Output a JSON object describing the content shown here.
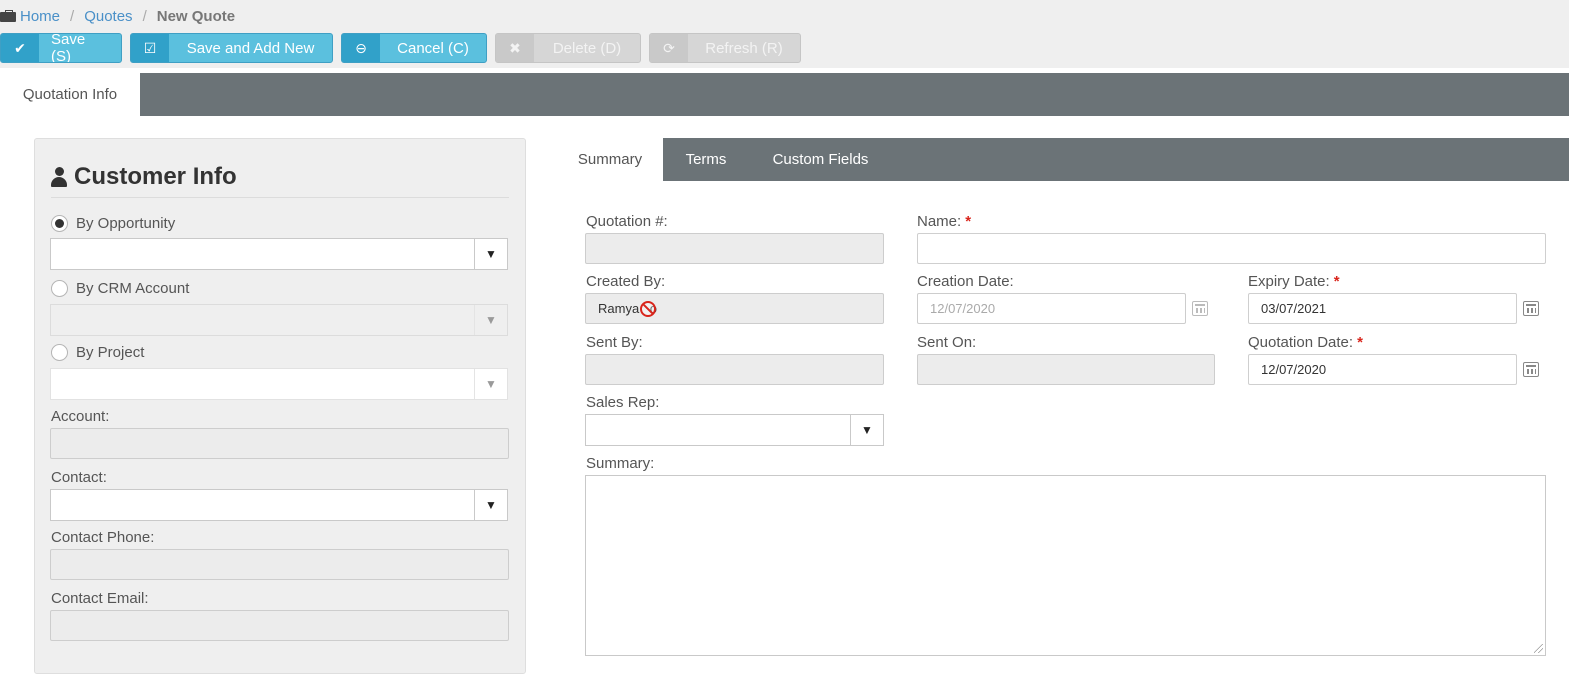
{
  "breadcrumb": {
    "home": "Home",
    "sep1": "/",
    "quotes": "Quotes",
    "sep2": "/",
    "current": "New Quote"
  },
  "toolbar": {
    "save": "Save (S)",
    "save_add": "Save and Add New",
    "cancel": "Cancel (C)",
    "delete": "Delete (D)",
    "refresh": "Refresh (R)"
  },
  "icons": {
    "save": "✔",
    "save_add": "☑",
    "cancel": "⊖",
    "delete": "✖",
    "refresh": "⟳",
    "dropdown": "▼"
  },
  "outer_tab": "Quotation Info",
  "customer": {
    "title": "Customer Info",
    "by_opportunity": "By Opportunity",
    "by_crm_account": "By CRM Account",
    "by_project": "By Project",
    "account_label": "Account:",
    "contact_label": "Contact:",
    "contact_phone_label": "Contact Phone:",
    "contact_email_label": "Contact Email:"
  },
  "inner_tabs": [
    "Summary",
    "Terms",
    "Custom Fields"
  ],
  "form": {
    "quotation_no_label": "Quotation #:",
    "name_label": "Name:",
    "required_mark": "*",
    "created_by_label": "Created By:",
    "created_by_prefix": "Ramya ",
    "created_by_suffix": "o",
    "creation_date_label": "Creation Date:",
    "creation_date_value": "12/07/2020",
    "expiry_date_label": "Expiry Date:",
    "expiry_date_value": "03/07/2021",
    "sent_by_label": "Sent By:",
    "sent_on_label": "Sent On:",
    "quotation_date_label": "Quotation Date:",
    "quotation_date_value": "12/07/2020",
    "sales_rep_label": "Sales Rep:",
    "summary_label": "Summary:"
  },
  "colors": {
    "primary": "#5bc0de",
    "primary_dark": "#31a1c9",
    "tabbar": "#6b7377",
    "required": "#d9251c",
    "link": "#4a90c8"
  }
}
